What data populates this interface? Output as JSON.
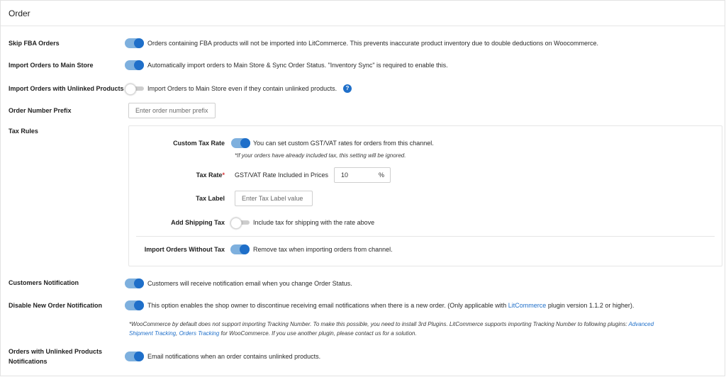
{
  "header": {
    "title": "Order"
  },
  "skip_fba": {
    "label": "Skip FBA Orders",
    "enabled": true,
    "description": "Orders containing FBA products will not be imported into LitCommerce. This prevents inaccurate product inventory due to double deductions on Woocommerce."
  },
  "import_main": {
    "label": "Import Orders to Main Store",
    "enabled": true,
    "description": "Automatically import orders to Main Store & Sync Order Status. \"Inventory Sync\" is required to enable this."
  },
  "import_unlinked": {
    "label": "Import Orders with Unlinked Products",
    "enabled": false,
    "description": "Import Orders to Main Store even if they contain unlinked products.",
    "help_icon": "?"
  },
  "prefix": {
    "label": "Order Number Prefix",
    "placeholder": "Enter order number prefix"
  },
  "tax_rules": {
    "label": "Tax Rules",
    "custom_rate": {
      "label": "Custom Tax Rate",
      "enabled": true,
      "description": "You can set custom GST/VAT rates for orders from this channel.",
      "note": "*If your orders have already included tax, this setting will be ignored."
    },
    "tax_rate": {
      "label": "Tax Rate",
      "required_mark": "*",
      "description": "GST/VAT Rate Included in Prices",
      "value": "10",
      "unit": "%"
    },
    "tax_label": {
      "label": "Tax Label",
      "placeholder": "Enter Tax Label value"
    },
    "shipping_tax": {
      "label": "Add Shipping Tax",
      "enabled": false,
      "description": "Include tax for shipping with the rate above"
    },
    "without_tax": {
      "label": "Import Orders Without Tax",
      "enabled": true,
      "description": "Remove tax when importing orders from channel."
    }
  },
  "customers_notification": {
    "label": "Customers Notification",
    "enabled": true,
    "description": "Customers will receive notification email when you change Order Status."
  },
  "disable_new_order": {
    "label": "Disable New Order Notification",
    "enabled": true,
    "description_before": "This option enables the shop owner to discontinue receiving email notifications when there is a new order. (Only applicable with ",
    "description_link": "LitCommerce",
    "description_after": " plugin version 1.1.2 or higher)."
  },
  "tracking_note": {
    "line1_before": "*WooCommerce by default does not support importing Tracking Number. To make this possible, you need to install 3rd Plugins. LitCommerce supports importing Tracking Number to following plugins: ",
    "link1a": "Advanced",
    "link1b": "Shipment Tracking",
    "sep": ", ",
    "link2": "Orders Tracking",
    "line2_after": " for WooCommerce. If you use another plugin, please contact us for a solution."
  },
  "unlinked_notifications": {
    "label_line1": "Orders with Unlinked Products",
    "label_line2": "Notifications",
    "enabled": true,
    "description": "Email notifications when an order contains unlinked products."
  }
}
